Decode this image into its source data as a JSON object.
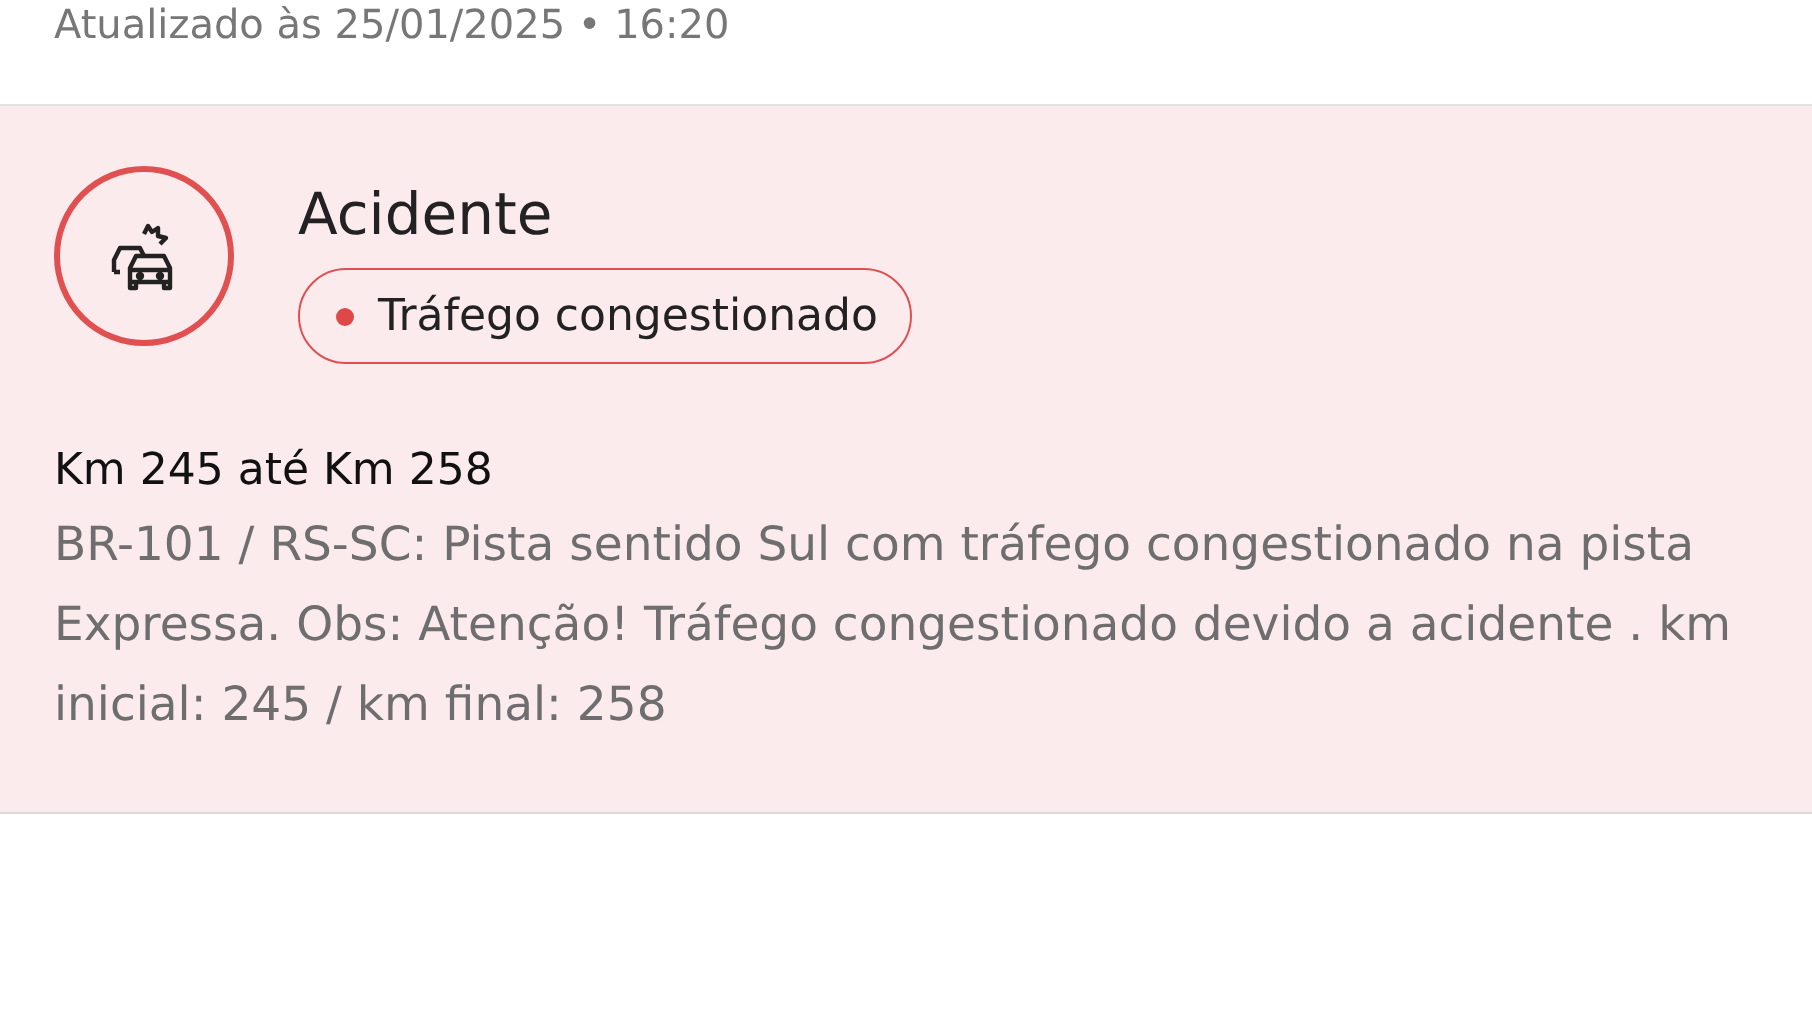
{
  "updated": "Atualizado às 25/01/2025 • 16:20",
  "incident": {
    "title": "Acidente",
    "status": {
      "label": "Tráfego congestionado",
      "color": "#e04848"
    },
    "range": "Km 245 até Km 258",
    "description": "BR-101 / RS-SC: Pista sentido Sul com tráfego congestionado na pista Expressa. Obs: Atenção! Tráfego congestionado devido a acidente . km inicial: 245 / km final: 258"
  }
}
